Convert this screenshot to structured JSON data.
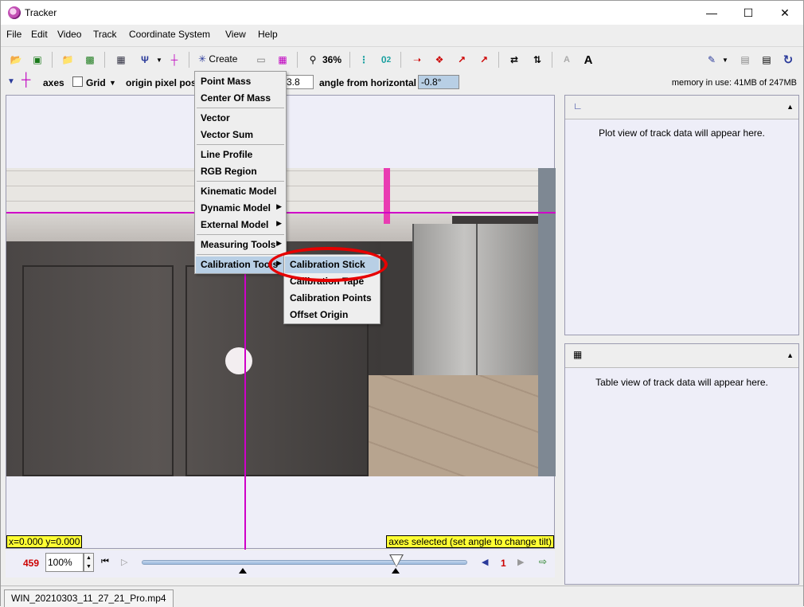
{
  "window": {
    "title": "Tracker"
  },
  "menubar": [
    "File",
    "Edit",
    "Video",
    "Track",
    "Coordinate System",
    "View",
    "Help"
  ],
  "toolbar": {
    "create_label": "Create",
    "zoom_label": "36%",
    "o1_label": "0",
    "o2_label": "2"
  },
  "axesbar": {
    "axes_label": "axes",
    "grid_label": "Grid",
    "origin_label": "origin pixel pos",
    "origin_value": "3.8",
    "angle_label": "angle from horizontal",
    "angle_value": "-0.8°",
    "memory": "memory in use: 41MB of 247MB"
  },
  "video": {
    "coords": "x=0.000  y=0.000",
    "status": "axes selected (set angle to change tilt)"
  },
  "player": {
    "frame": "459",
    "zoom": "100%",
    "step": "1"
  },
  "plot_panel": {
    "text": "Plot view of track data will appear here."
  },
  "table_panel": {
    "text": "Table view of track data will appear here."
  },
  "file_tab": "WIN_20210303_11_27_21_Pro.mp4",
  "create_menu": {
    "items": [
      "Point Mass",
      "Center Of Mass",
      "Vector",
      "Vector Sum",
      "Line Profile",
      "RGB Region",
      "Kinematic Model",
      "Dynamic Model",
      "External Model",
      "Measuring Tools",
      "Calibration Tools"
    ]
  },
  "calibration_submenu": {
    "items": [
      "Calibration Stick",
      "Calibration Tape",
      "Calibration Points",
      "Offset Origin"
    ]
  },
  "colors": {
    "axis": "#d000c8",
    "highlight": "#b8cfe5",
    "annotation_circle": "#e60000",
    "label_bg": "#ffff33"
  }
}
